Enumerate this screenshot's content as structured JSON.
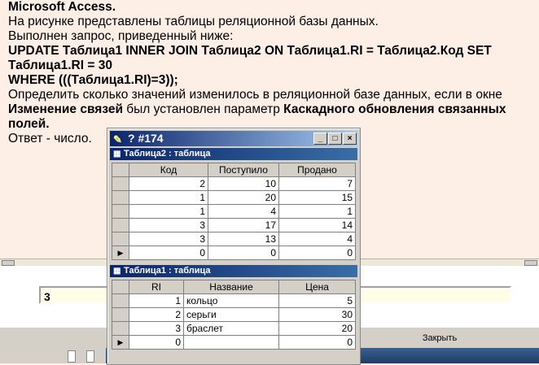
{
  "question": {
    "title": "Microsoft Access.",
    "line1": "На рисунке представлены таблицы реляционной базы данных.",
    "line2": "Выполнен запрос, приведенный ниже:",
    "sql1": "UPDATE Таблица1 INNER JOIN Таблица2 ON Таблица1.RI = Таблица2.Код SET",
    "sql2": "Таблица1.RI = 30",
    "sql3": "WHERE (((Таблица1.RI)=3));",
    "line3": "Определить сколько значений изменилось в реляционной базе данных, если в окне",
    "bold1": "Изменение связей",
    "line4": " был установлен параметр ",
    "bold2": "Каскадного обновления связанных",
    "bold3": "полей.",
    "line5": "Ответ - число."
  },
  "answer": {
    "value": "3"
  },
  "bottom": {
    "close_label": "Закрыть"
  },
  "window": {
    "title": "? #174",
    "minimize": "_",
    "maximize": "□",
    "close": "×",
    "table2": {
      "title": "Таблица2 : таблица",
      "headers": [
        "Код",
        "Поступило",
        "Продано"
      ],
      "rows": [
        [
          "2",
          "10",
          "7"
        ],
        [
          "1",
          "20",
          "15"
        ],
        [
          "1",
          "4",
          "1"
        ],
        [
          "3",
          "17",
          "14"
        ],
        [
          "3",
          "13",
          "4"
        ],
        [
          "0",
          "0",
          "0"
        ]
      ]
    },
    "table1": {
      "title": "Таблица1 : таблица",
      "headers": [
        "RI",
        "Название",
        "Цена"
      ],
      "rows": [
        [
          "1",
          "кольцо",
          "5"
        ],
        [
          "2",
          "серьги",
          "30"
        ],
        [
          "3",
          "браслет",
          "20"
        ],
        [
          "0",
          "",
          "0"
        ]
      ]
    }
  }
}
